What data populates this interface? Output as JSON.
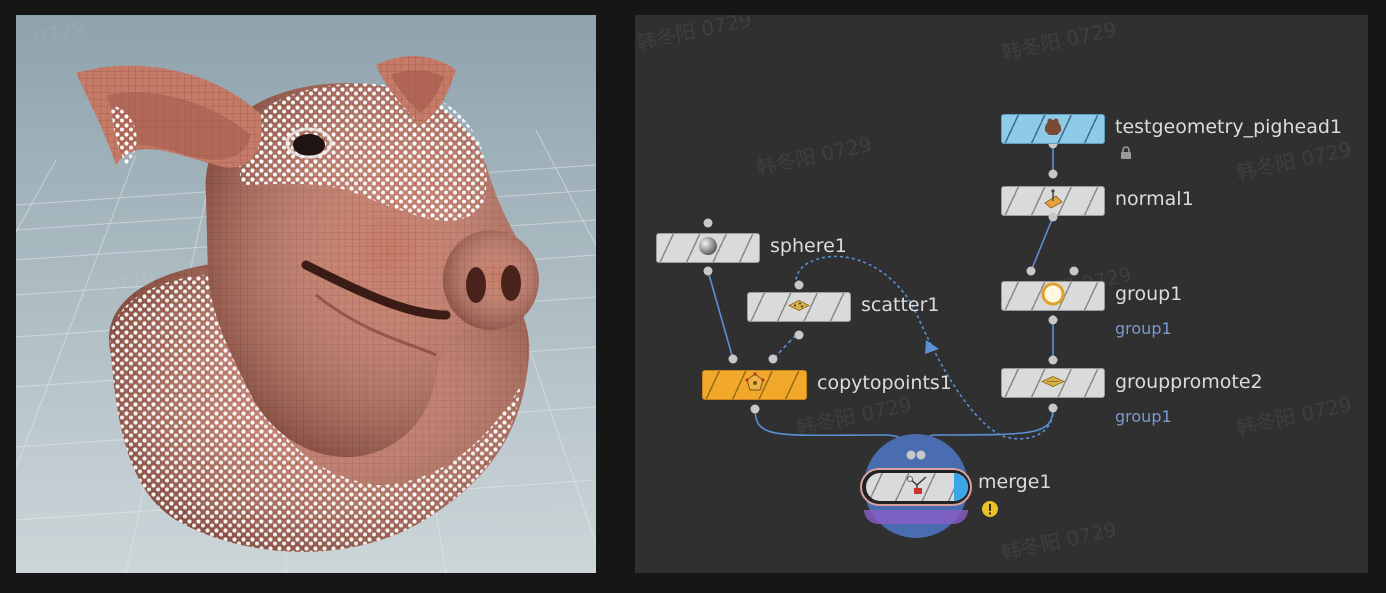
{
  "viewport": {
    "background_top": "#9eb0b8",
    "background_bottom": "#c9d3d6",
    "skin_color": "#c97f6c",
    "point_color": "#ffffff"
  },
  "network": {
    "background": "#303030",
    "nodes": [
      {
        "id": "testgeometry_pighead1",
        "label": "testgeometry_pighead1",
        "icon": "pig-head-icon",
        "color": "#8ecbe8",
        "locked": true,
        "lock_icon": "lock-icon"
      },
      {
        "id": "normal1",
        "label": "normal1",
        "icon": "normal-icon"
      },
      {
        "id": "sphere1",
        "label": "sphere1",
        "icon": "sphere-icon"
      },
      {
        "id": "scatter1",
        "label": "scatter1",
        "icon": "scatter-icon"
      },
      {
        "id": "group1",
        "label": "group1",
        "sublabel": "group1",
        "icon": "group-icon"
      },
      {
        "id": "copytopoints1",
        "label": "copytopoints1",
        "icon": "copy-to-points-icon",
        "color": "#f2a92b"
      },
      {
        "id": "grouppromote2",
        "label": "grouppromote2",
        "sublabel": "group1",
        "icon": "group-promote-icon"
      },
      {
        "id": "merge1",
        "label": "merge1",
        "icon": "merge-icon",
        "warning_icon": "warning-icon",
        "selected": true
      }
    ],
    "wire_color": "#5b8fd6"
  },
  "watermark": "韩冬阳 0729"
}
